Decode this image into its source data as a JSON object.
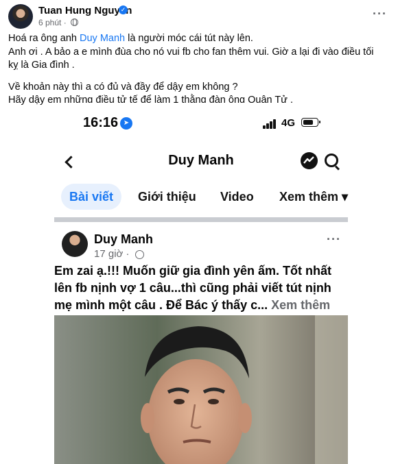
{
  "post": {
    "author": "Tuan Hung Nguyen",
    "time": "6 phút ·",
    "more": "···",
    "line1_before": "Hoá ra ông anh ",
    "line1_mention": "Duy Manh",
    "line1_after": " là người móc cái tút này lên.",
    "line2": "Anh ơi . A bảo a e mình đùa cho nó vui fb cho fan thêm vui. Giờ a lại đi vào  điều tối kỵ là Gia đình .",
    "line3": "Về khoản này thì a có đủ và đầy để dậy em không ?",
    "line4": "Hãy dậy em những điều tử tế để làm 1 thằng đàn ông Quân Tử ."
  },
  "screenshot": {
    "status_time": "16:16",
    "network": "4G",
    "page_title": "Duy Manh",
    "tabs": [
      "Bài viết",
      "Giới thiệu",
      "Video",
      "Xem thêm ▾"
    ],
    "inner_author": "Duy Manh",
    "inner_time": "17 giờ ·",
    "inner_more": "···",
    "inner_text": "Em zai ạ.!!! Muốn giữ gia đình yên ấm. Tốt nhất lên fb nịnh vợ 1 câu...thì cũng phải viết tút nịnh mẹ mình một câu . Để Bác ý thấy c...",
    "see_more": " Xem thêm"
  },
  "colors": {
    "accent": "#1877f2",
    "muted": "#65676b"
  },
  "icons": [
    "verified-icon",
    "globe-icon",
    "location-icon",
    "signal-icon",
    "battery-icon",
    "back-icon",
    "messenger-icon",
    "search-icon",
    "more-icon"
  ]
}
